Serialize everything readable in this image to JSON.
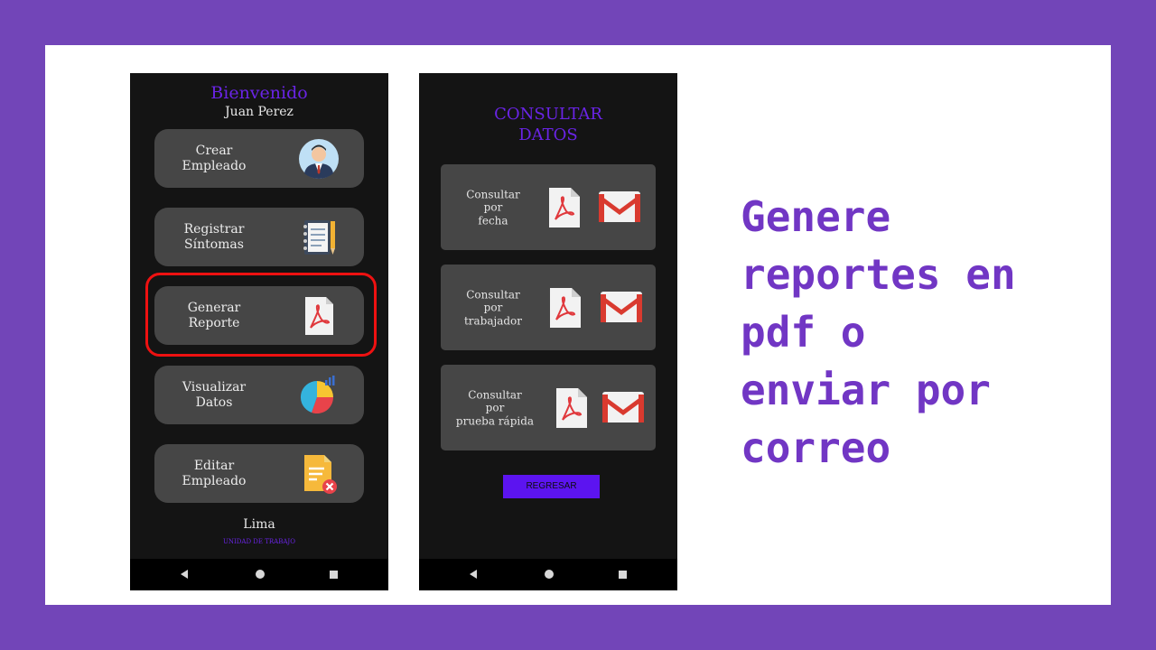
{
  "phone_main": {
    "welcome": "Bienvenido",
    "user_name": "Juan Perez",
    "menu": [
      {
        "label": "Crear\nEmpleado",
        "icon": "employee-avatar-icon"
      },
      {
        "label": "Registrar\nSíntomas",
        "icon": "notebook-icon"
      },
      {
        "label": "Generar\nReporte",
        "icon": "pdf-file-icon"
      },
      {
        "label": "Visualizar\nDatos",
        "icon": "pie-chart-icon"
      },
      {
        "label": "Editar\nEmpleado",
        "icon": "edit-document-icon"
      }
    ],
    "city": "Lima",
    "unit": "UNIDAD DE TRABAJO"
  },
  "phone_query": {
    "title": "CONSULTAR\nDATOS",
    "queries": [
      {
        "label": "Consultar\npor\nfecha"
      },
      {
        "label": "Consultar\npor\ntrabajador"
      },
      {
        "label": "Consultar\npor\nprueba rápida"
      }
    ],
    "back_label": "REGRESAR"
  },
  "caption": "Genere\nreportes en\npdf o\nenviar por\ncorreo",
  "colors": {
    "frame": "#7245b8",
    "accent": "#6a24e6",
    "highlight": "#ee1111",
    "caption": "#7136c4"
  }
}
